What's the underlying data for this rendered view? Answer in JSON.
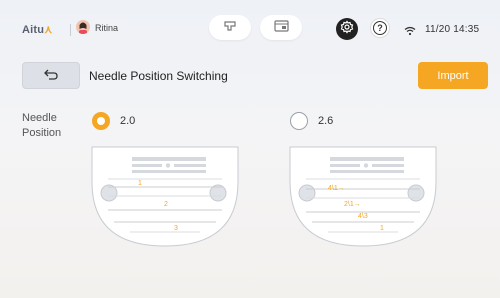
{
  "header": {
    "logo_text": "Aitu",
    "username": "Ritina",
    "clock": "11/20 14:35",
    "icons": [
      "stitch-mode-icon",
      "screen-settings-icon",
      "gear-icon",
      "help-icon",
      "wifi-icon"
    ],
    "accent_color": "#f5a623"
  },
  "page": {
    "title": "Needle Position Switching",
    "import_label": "Import"
  },
  "needle_position": {
    "label_line1": "Needle",
    "label_line2": "Position",
    "options": [
      {
        "label": "2.0",
        "selected": true,
        "markers": [
          "1",
          "2",
          "3"
        ]
      },
      {
        "label": "2.6",
        "selected": false,
        "markers": [
          "4\\1→",
          "2\\1→",
          "4\\3",
          "1"
        ]
      }
    ]
  }
}
